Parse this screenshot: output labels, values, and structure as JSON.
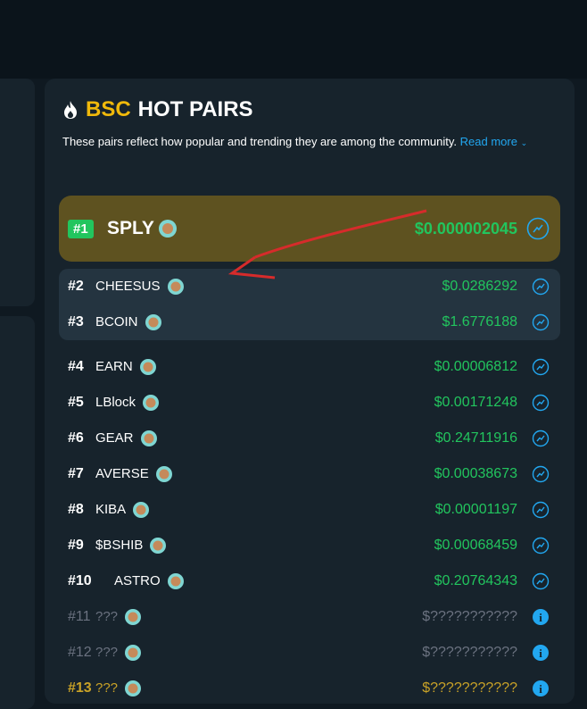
{
  "header": {
    "chain": "BSC",
    "title": "HOT PAIRS",
    "description": "These pairs reflect how popular and trending they are among the community.",
    "read_more": "Read more"
  },
  "colors": {
    "accent": "#f0b90b",
    "positive": "#22c55e",
    "link": "#22a7f0",
    "top_highlight": "#5e5220"
  },
  "top_pair": {
    "rank": "#1",
    "symbol": "SPLY",
    "price": "$0.000002045"
  },
  "pairs": [
    {
      "rank": "#2",
      "symbol": "CHEESUS",
      "price": "$0.0286292"
    },
    {
      "rank": "#3",
      "symbol": "BCOIN",
      "price": "$1.6776188"
    },
    {
      "rank": "#4",
      "symbol": "EARN",
      "price": "$0.00006812"
    },
    {
      "rank": "#5",
      "symbol": "LBlock",
      "price": "$0.00171248"
    },
    {
      "rank": "#6",
      "symbol": "GEAR",
      "price": "$0.24711916"
    },
    {
      "rank": "#7",
      "symbol": "AVERSE",
      "price": "$0.00038673"
    },
    {
      "rank": "#8",
      "symbol": "KIBA",
      "price": "$0.00001197"
    },
    {
      "rank": "#9",
      "symbol": "$BSHIB",
      "price": "$0.00068459"
    },
    {
      "rank": "#10",
      "symbol": "ASTRO",
      "price": "$0.20764343"
    },
    {
      "rank": "#11",
      "symbol": "???",
      "price": "$???????????"
    },
    {
      "rank": "#12",
      "symbol": "???",
      "price": "$???????????"
    },
    {
      "rank": "#13",
      "symbol": "???",
      "price": "$???????????"
    }
  ],
  "icons": {
    "fire": "fire-icon",
    "coin": "bsc-coin-icon",
    "chart_action": "chart-link-icon",
    "info": "info-icon"
  }
}
